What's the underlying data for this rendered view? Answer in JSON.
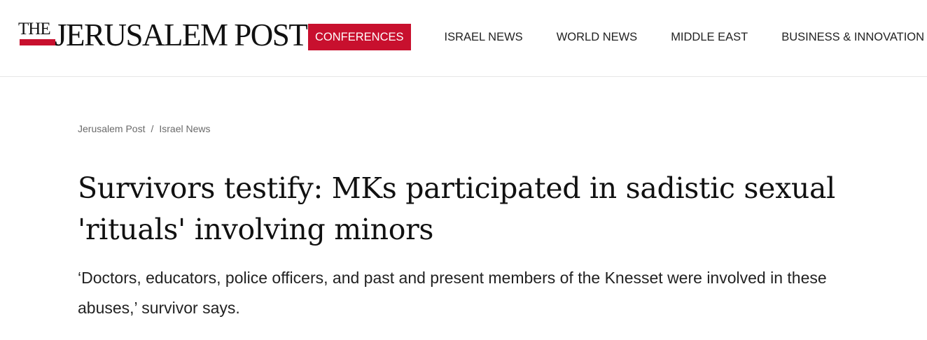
{
  "header": {
    "logo": {
      "the": "THE",
      "name": "JERUSALEM POST"
    },
    "nav": [
      {
        "label": "CONFERENCES",
        "highlighted": true
      },
      {
        "label": "ISRAEL NEWS",
        "highlighted": false
      },
      {
        "label": "WORLD NEWS",
        "highlighted": false
      },
      {
        "label": "MIDDLE EAST",
        "highlighted": false
      },
      {
        "label": "BUSINESS & INNOVATION",
        "highlighted": false
      }
    ]
  },
  "breadcrumb": {
    "items": [
      "Jerusalem Post",
      "Israel News"
    ],
    "separator": "/"
  },
  "article": {
    "headline": "Survivors testify: MKs participated in sadistic sexual 'rituals' involving minors",
    "subhead": "‘Doctors, educators, police officers, and past and present members of the Knesset were involved in these abuses,’ survivor says."
  },
  "colors": {
    "brand_red": "#c8102e",
    "text": "#111111",
    "muted": "#6a6a6a"
  }
}
